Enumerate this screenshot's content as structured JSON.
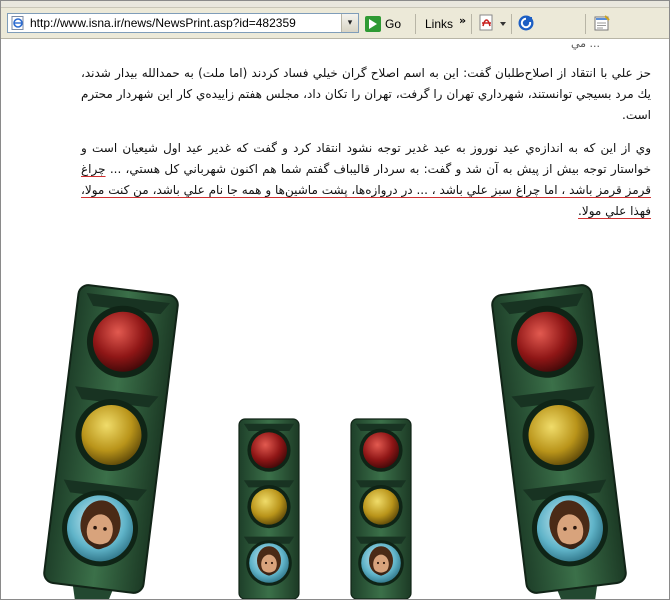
{
  "browser": {
    "address_url": "http://www.isna.ir/news/NewsPrint.asp?id=482359",
    "go_label": "Go",
    "links_label": "Links",
    "links_chevron": "»",
    "address_dropdown": "▾",
    "icons": [
      "ie-page-icon",
      "go-arrow-icon",
      "pdf-icon",
      "dropdown-arrow-icon",
      "circle-logo-icon",
      "notes-icon"
    ]
  },
  "article": {
    "clipped_line": "... مي",
    "paragraph1": "حز علي با انتقاد از اصلاح‌طلبان گفت: اين به اسم اصلاح گران خيلي فساد كردند (اما ملت) به حمدالله بيدار شدند، يك مرد بسيجي توانستند، شهرداري تهران را گرفت، تهران را تكان داد، مجلس هفتم زاييده‌ي كار اين شهردار محترم است.",
    "paragraph2_plain": "وي از اين كه به اندازه‌ي عيد نوروز به عيد غدير توجه نشود انتقاد كرد و گفت كه غدير عيد اول شيعيان است و خواستار توجه بيش از پيش به آن شد و گفت: به سردار قاليباف گفتم شما هم اكنون شهرباني كل هستي، ... ",
    "paragraph2_underlined": "چراغ قرمز قرمز باشد ، اما چراغ سبز علي باشد ، ... در دروازه‌ها، پشت ماشين‌ها و همه جا نام علي باشد، من كنت مولا، فهذا علي مولا."
  },
  "illustration": {
    "description_icon": "traffic-light-icon",
    "colors": {
      "housing": "#2f5c3c",
      "red": "#a32020",
      "yellow": "#c7a41d",
      "glass": "#5fb3c8"
    }
  }
}
